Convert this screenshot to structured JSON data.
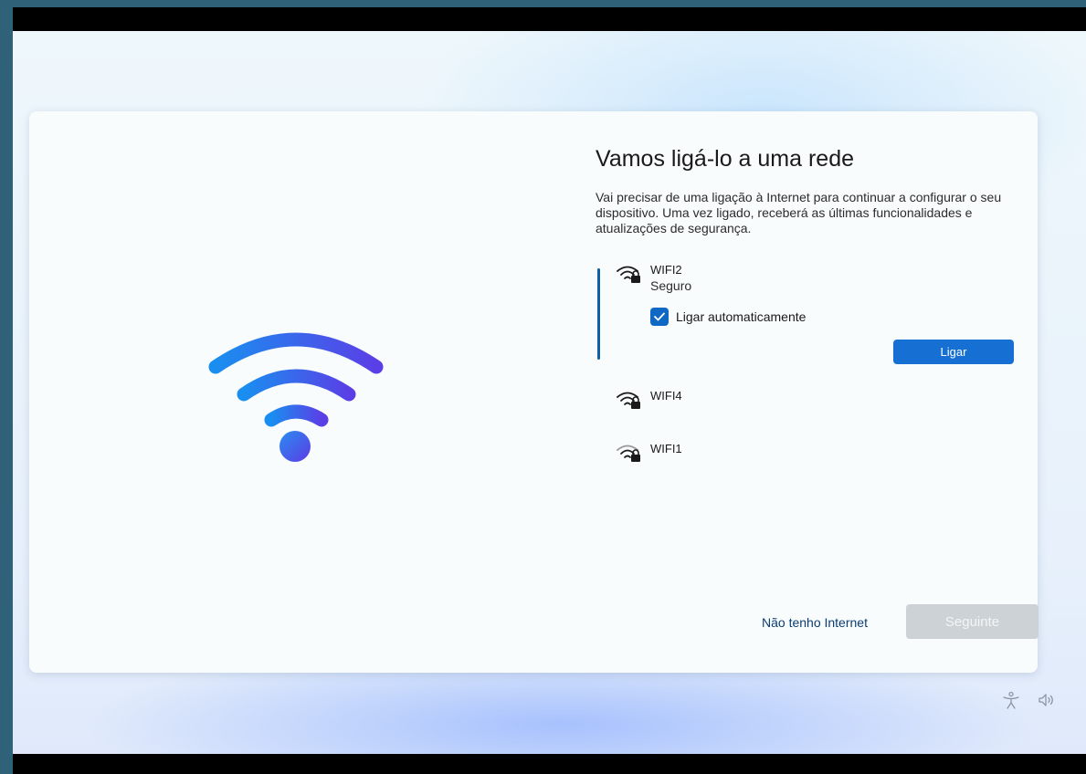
{
  "dialog": {
    "title": "Vamos ligá-lo a uma rede",
    "description": "Vai precisar de uma ligação à Internet para continuar a configurar o seu dispositivo. Uma vez ligado, receberá as últimas funcionalidades e atualizações de segurança."
  },
  "networks": [
    {
      "name": "WIFI2",
      "status": "Seguro",
      "selected": true,
      "icon": "wifi-secured-icon"
    },
    {
      "name": "WIFI4",
      "icon": "wifi-secured-icon"
    },
    {
      "name": "WIFI1",
      "icon": "wifi-secured-icon"
    }
  ],
  "selected_network": {
    "auto_connect_label": "Ligar automaticamente",
    "auto_connect_checked": true,
    "connect_label": "Ligar"
  },
  "footer": {
    "no_internet_label": "Não tenho Internet",
    "next_label": "Seguinte",
    "next_enabled": false
  },
  "system_icons": [
    "accessibility-icon",
    "volume-icon"
  ],
  "colors": {
    "accent": "#1670d4",
    "selection_bar": "#0f5ea8",
    "disabled_button": "#cdd2d6",
    "link": "#0b3d73"
  }
}
